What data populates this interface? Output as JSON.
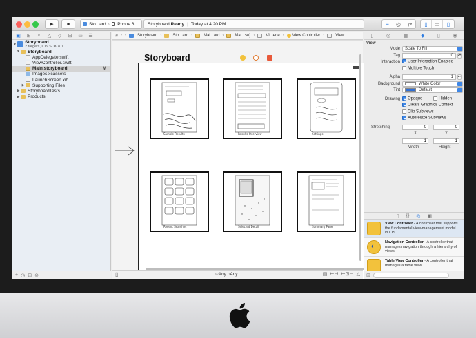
{
  "toolbar": {
    "scheme_target": "Sto...ard",
    "scheme_device": "iPhone 6",
    "status_prefix": "Storyboard: ",
    "status_bold": "Ready",
    "status_time": "Today at 4:20 PM"
  },
  "navigator": {
    "items": [
      {
        "label": "Storyboard",
        "sub": "2 targets, iOS SDK 8.1",
        "icon": "project-icon"
      },
      {
        "label": "Storyboard",
        "icon": "folder-icon"
      },
      {
        "label": "AppDelegate.swift",
        "icon": "swift-file-icon"
      },
      {
        "label": "ViewController.swift",
        "icon": "swift-file-icon"
      },
      {
        "label": "Main.storyboard",
        "icon": "storyboard-file-icon",
        "badge": "M"
      },
      {
        "label": "Images.xcassets",
        "icon": "asset-catalog-icon"
      },
      {
        "label": "LaunchScreen.xib",
        "icon": "xib-file-icon"
      },
      {
        "label": "Supporting Files",
        "icon": "folder-icon"
      },
      {
        "label": "StoryboardTests",
        "icon": "folder-icon"
      },
      {
        "label": "Products",
        "icon": "folder-icon"
      }
    ]
  },
  "jumpbar": {
    "crumbs": [
      "Storyboard",
      "Sto...ard",
      "Mai...ard",
      "Mai...se)",
      "Vi...ene",
      "View Controller",
      "View"
    ]
  },
  "canvas": {
    "scene_title": "Storyboard",
    "sketch_labels": [
      "Sample Results",
      "Results Overview",
      "Settings",
      "Recent Searches",
      "Selected Detail",
      "Summary Panel"
    ]
  },
  "editor_bottom": {
    "size_w": "Any",
    "size_h": "Any",
    "w_prefix": "w",
    "h_prefix": "h"
  },
  "inspector": {
    "section": "View",
    "mode_label": "Mode",
    "mode_value": "Scale To Fill",
    "tag_label": "Tag",
    "tag_value": "0",
    "interaction_label": "Interaction",
    "user_interaction": "User Interaction Enabled",
    "multiple_touch": "Multiple Touch",
    "alpha_label": "Alpha",
    "alpha_value": "1",
    "background_label": "Background",
    "background_value": "White Color",
    "tint_label": "Tint",
    "tint_value": "Default",
    "drawing_label": "Drawing",
    "opaque": "Opaque",
    "hidden": "Hidden",
    "clears": "Clears Graphics Context",
    "clip": "Clip Subviews",
    "autoresize": "Autoresize Subviews",
    "stretching_label": "Stretching",
    "x_value": "0",
    "y_value": "0",
    "width_value": "1",
    "height_value": "1",
    "x_label": "X",
    "y_label": "Y",
    "width_label": "Width",
    "height_label": "Height"
  },
  "library": {
    "items": [
      {
        "title": "View Controller",
        "desc": " - A controller that supports the fundamental view-management model in iOS."
      },
      {
        "title": "Navigation Controller",
        "desc": " - A controller that manages navigation through a hierarchy of views."
      },
      {
        "title": "Table View Controller",
        "desc": " - A controller that manages a table view."
      }
    ]
  },
  "colors": {
    "accent": "#2f7de1",
    "library_icon": "#f2c23c"
  }
}
